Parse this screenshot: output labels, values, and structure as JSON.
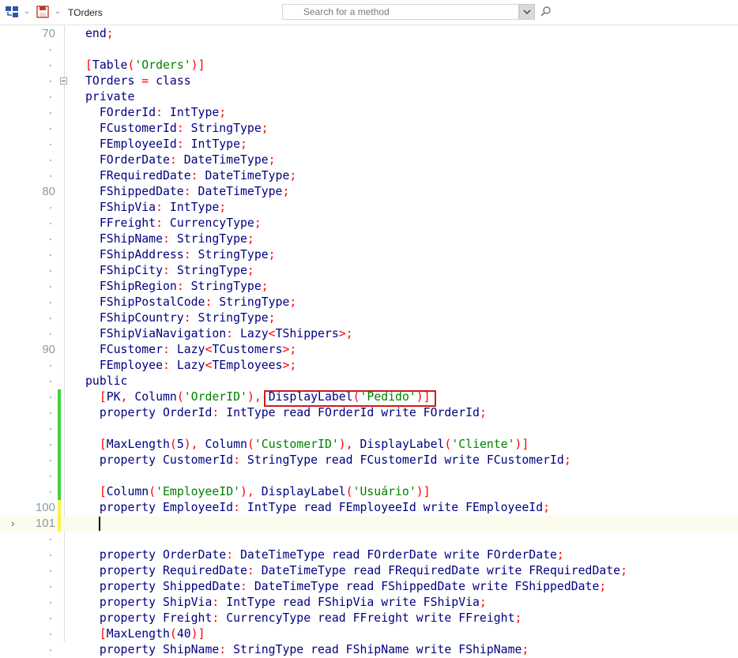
{
  "toolbar": {
    "class_name": "TOrders",
    "search": {
      "placeholder": "Search for a method"
    }
  },
  "editor": {
    "lines": [
      {
        "num": "70",
        "tokens": [
          {
            "t": "end",
            "c": "k"
          },
          {
            "t": ";",
            "c": "p"
          }
        ]
      },
      {
        "num": "",
        "tokens": []
      },
      {
        "num": "",
        "tokens": [
          {
            "t": "[",
            "c": "p"
          },
          {
            "t": "Table",
            "c": "i"
          },
          {
            "t": "(",
            "c": "p"
          },
          {
            "t": "'Orders'",
            "c": "s"
          },
          {
            "t": ")",
            "c": "p"
          },
          {
            "t": "]",
            "c": "p"
          }
        ]
      },
      {
        "num": "",
        "fold": true,
        "tokens": [
          {
            "t": "TOrders ",
            "c": "i"
          },
          {
            "t": "=",
            "c": "p"
          },
          {
            "t": " class",
            "c": "k"
          }
        ]
      },
      {
        "num": "",
        "tokens": [
          {
            "t": "private",
            "c": "k"
          }
        ]
      },
      {
        "num": "",
        "tokens": [
          {
            "t": "  FOrderId",
            "c": "i"
          },
          {
            "t": ":",
            "c": "p"
          },
          {
            "t": " IntType",
            "c": "i"
          },
          {
            "t": ";",
            "c": "p"
          }
        ]
      },
      {
        "num": "",
        "tokens": [
          {
            "t": "  FCustomerId",
            "c": "i"
          },
          {
            "t": ":",
            "c": "p"
          },
          {
            "t": " StringType",
            "c": "i"
          },
          {
            "t": ";",
            "c": "p"
          }
        ]
      },
      {
        "num": "",
        "tokens": [
          {
            "t": "  FEmployeeId",
            "c": "i"
          },
          {
            "t": ":",
            "c": "p"
          },
          {
            "t": " IntType",
            "c": "i"
          },
          {
            "t": ";",
            "c": "p"
          }
        ]
      },
      {
        "num": "",
        "tokens": [
          {
            "t": "  FOrderDate",
            "c": "i"
          },
          {
            "t": ":",
            "c": "p"
          },
          {
            "t": " DateTimeType",
            "c": "i"
          },
          {
            "t": ";",
            "c": "p"
          }
        ]
      },
      {
        "num": "",
        "tokens": [
          {
            "t": "  FRequiredDate",
            "c": "i"
          },
          {
            "t": ":",
            "c": "p"
          },
          {
            "t": " DateTimeType",
            "c": "i"
          },
          {
            "t": ";",
            "c": "p"
          }
        ]
      },
      {
        "num": "80",
        "tokens": [
          {
            "t": "  FShippedDate",
            "c": "i"
          },
          {
            "t": ":",
            "c": "p"
          },
          {
            "t": " DateTimeType",
            "c": "i"
          },
          {
            "t": ";",
            "c": "p"
          }
        ]
      },
      {
        "num": "",
        "tokens": [
          {
            "t": "  FShipVia",
            "c": "i"
          },
          {
            "t": ":",
            "c": "p"
          },
          {
            "t": " IntType",
            "c": "i"
          },
          {
            "t": ";",
            "c": "p"
          }
        ]
      },
      {
        "num": "",
        "tokens": [
          {
            "t": "  FFreight",
            "c": "i"
          },
          {
            "t": ":",
            "c": "p"
          },
          {
            "t": " CurrencyType",
            "c": "i"
          },
          {
            "t": ";",
            "c": "p"
          }
        ]
      },
      {
        "num": "",
        "tokens": [
          {
            "t": "  FShipName",
            "c": "i"
          },
          {
            "t": ":",
            "c": "p"
          },
          {
            "t": " StringType",
            "c": "i"
          },
          {
            "t": ";",
            "c": "p"
          }
        ]
      },
      {
        "num": "",
        "tokens": [
          {
            "t": "  FShipAddress",
            "c": "i"
          },
          {
            "t": ":",
            "c": "p"
          },
          {
            "t": " StringType",
            "c": "i"
          },
          {
            "t": ";",
            "c": "p"
          }
        ]
      },
      {
        "num": "",
        "tokens": [
          {
            "t": "  FShipCity",
            "c": "i"
          },
          {
            "t": ":",
            "c": "p"
          },
          {
            "t": " StringType",
            "c": "i"
          },
          {
            "t": ";",
            "c": "p"
          }
        ]
      },
      {
        "num": "",
        "tokens": [
          {
            "t": "  FShipRegion",
            "c": "i"
          },
          {
            "t": ":",
            "c": "p"
          },
          {
            "t": " StringType",
            "c": "i"
          },
          {
            "t": ";",
            "c": "p"
          }
        ]
      },
      {
        "num": "",
        "tokens": [
          {
            "t": "  FShipPostalCode",
            "c": "i"
          },
          {
            "t": ":",
            "c": "p"
          },
          {
            "t": " StringType",
            "c": "i"
          },
          {
            "t": ";",
            "c": "p"
          }
        ]
      },
      {
        "num": "",
        "tokens": [
          {
            "t": "  FShipCountry",
            "c": "i"
          },
          {
            "t": ":",
            "c": "p"
          },
          {
            "t": " StringType",
            "c": "i"
          },
          {
            "t": ";",
            "c": "p"
          }
        ]
      },
      {
        "num": "",
        "tokens": [
          {
            "t": "  FShipViaNavigation",
            "c": "i"
          },
          {
            "t": ":",
            "c": "p"
          },
          {
            "t": " Lazy",
            "c": "i"
          },
          {
            "t": "<",
            "c": "p"
          },
          {
            "t": "TShippers",
            "c": "i"
          },
          {
            "t": ">;",
            "c": "p"
          }
        ]
      },
      {
        "num": "90",
        "tokens": [
          {
            "t": "  FCustomer",
            "c": "i"
          },
          {
            "t": ":",
            "c": "p"
          },
          {
            "t": " Lazy",
            "c": "i"
          },
          {
            "t": "<",
            "c": "p"
          },
          {
            "t": "TCustomers",
            "c": "i"
          },
          {
            "t": ">;",
            "c": "p"
          }
        ]
      },
      {
        "num": "",
        "tokens": [
          {
            "t": "  FEmployee",
            "c": "i"
          },
          {
            "t": ":",
            "c": "p"
          },
          {
            "t": " Lazy",
            "c": "i"
          },
          {
            "t": "<",
            "c": "p"
          },
          {
            "t": "TEmployees",
            "c": "i"
          },
          {
            "t": ">;",
            "c": "p"
          }
        ]
      },
      {
        "num": "",
        "tokens": [
          {
            "t": "public",
            "c": "k"
          }
        ]
      },
      {
        "num": "",
        "bar": "green",
        "boxed": true,
        "tokens": [
          {
            "t": "  [",
            "c": "p"
          },
          {
            "t": "PK",
            "c": "i"
          },
          {
            "t": ",",
            "c": "p"
          },
          {
            "t": " Column",
            "c": "i"
          },
          {
            "t": "(",
            "c": "p"
          },
          {
            "t": "'OrderID'",
            "c": "s"
          },
          {
            "t": "),",
            "c": "p"
          },
          {
            "t": " DisplayLabel",
            "c": "i"
          },
          {
            "t": "(",
            "c": "p"
          },
          {
            "t": "'Pedido'",
            "c": "s"
          },
          {
            "t": ")",
            "c": "p"
          },
          {
            "t": "]",
            "c": "p"
          }
        ]
      },
      {
        "num": "",
        "bar": "green",
        "tokens": [
          {
            "t": "  property",
            "c": "k"
          },
          {
            "t": " OrderId",
            "c": "i"
          },
          {
            "t": ":",
            "c": "p"
          },
          {
            "t": " IntType",
            "c": "i"
          },
          {
            "t": " read",
            "c": "k"
          },
          {
            "t": " FOrderId",
            "c": "i"
          },
          {
            "t": " write",
            "c": "k"
          },
          {
            "t": " FOrderId",
            "c": "i"
          },
          {
            "t": ";",
            "c": "p"
          }
        ]
      },
      {
        "num": "",
        "bar": "green",
        "tokens": []
      },
      {
        "num": "",
        "bar": "green",
        "tokens": [
          {
            "t": "  [",
            "c": "p"
          },
          {
            "t": "MaxLength",
            "c": "i"
          },
          {
            "t": "(",
            "c": "p"
          },
          {
            "t": "5",
            "c": "i"
          },
          {
            "t": "),",
            "c": "p"
          },
          {
            "t": " Column",
            "c": "i"
          },
          {
            "t": "(",
            "c": "p"
          },
          {
            "t": "'CustomerID'",
            "c": "s"
          },
          {
            "t": "),",
            "c": "p"
          },
          {
            "t": " DisplayLabel",
            "c": "i"
          },
          {
            "t": "(",
            "c": "p"
          },
          {
            "t": "'Cliente'",
            "c": "s"
          },
          {
            "t": ")",
            "c": "p"
          },
          {
            "t": "]",
            "c": "p"
          }
        ]
      },
      {
        "num": "",
        "bar": "green",
        "tokens": [
          {
            "t": "  property",
            "c": "k"
          },
          {
            "t": " CustomerId",
            "c": "i"
          },
          {
            "t": ":",
            "c": "p"
          },
          {
            "t": " StringType",
            "c": "i"
          },
          {
            "t": " read",
            "c": "k"
          },
          {
            "t": " FCustomerId",
            "c": "i"
          },
          {
            "t": " write",
            "c": "k"
          },
          {
            "t": " FCustomerId",
            "c": "i"
          },
          {
            "t": ";",
            "c": "p"
          }
        ]
      },
      {
        "num": "",
        "bar": "green",
        "tokens": []
      },
      {
        "num": "",
        "bar": "green",
        "tokens": [
          {
            "t": "  [",
            "c": "p"
          },
          {
            "t": "Column",
            "c": "i"
          },
          {
            "t": "(",
            "c": "p"
          },
          {
            "t": "'EmployeeID'",
            "c": "s"
          },
          {
            "t": "),",
            "c": "p"
          },
          {
            "t": " DisplayLabel",
            "c": "i"
          },
          {
            "t": "(",
            "c": "p"
          },
          {
            "t": "'Usuário'",
            "c": "s"
          },
          {
            "t": ")",
            "c": "p"
          },
          {
            "t": "]",
            "c": "p"
          }
        ]
      },
      {
        "num": "100",
        "bar": "yellow",
        "tokens": [
          {
            "t": "  property",
            "c": "k"
          },
          {
            "t": " EmployeeId",
            "c": "i"
          },
          {
            "t": ":",
            "c": "p"
          },
          {
            "t": " IntType",
            "c": "i"
          },
          {
            "t": " read",
            "c": "k"
          },
          {
            "t": " FEmployeeId",
            "c": "i"
          },
          {
            "t": " write",
            "c": "k"
          },
          {
            "t": " FEmployeeId",
            "c": "i"
          },
          {
            "t": ";",
            "c": "p"
          }
        ]
      },
      {
        "num": "101",
        "bar": "yellow",
        "current": true,
        "caret": "›",
        "tokens": []
      },
      {
        "num": "",
        "tokens": []
      },
      {
        "num": "",
        "tokens": [
          {
            "t": "  property",
            "c": "k"
          },
          {
            "t": " OrderDate",
            "c": "i"
          },
          {
            "t": ":",
            "c": "p"
          },
          {
            "t": " DateTimeType",
            "c": "i"
          },
          {
            "t": " read",
            "c": "k"
          },
          {
            "t": " FOrderDate",
            "c": "i"
          },
          {
            "t": " write",
            "c": "k"
          },
          {
            "t": " FOrderDate",
            "c": "i"
          },
          {
            "t": ";",
            "c": "p"
          }
        ]
      },
      {
        "num": "",
        "tokens": [
          {
            "t": "  property",
            "c": "k"
          },
          {
            "t": " RequiredDate",
            "c": "i"
          },
          {
            "t": ":",
            "c": "p"
          },
          {
            "t": " DateTimeType",
            "c": "i"
          },
          {
            "t": " read",
            "c": "k"
          },
          {
            "t": " FRequiredDate",
            "c": "i"
          },
          {
            "t": " write",
            "c": "k"
          },
          {
            "t": " FRequiredDate",
            "c": "i"
          },
          {
            "t": ";",
            "c": "p"
          }
        ]
      },
      {
        "num": "",
        "tokens": [
          {
            "t": "  property",
            "c": "k"
          },
          {
            "t": " ShippedDate",
            "c": "i"
          },
          {
            "t": ":",
            "c": "p"
          },
          {
            "t": " DateTimeType",
            "c": "i"
          },
          {
            "t": " read",
            "c": "k"
          },
          {
            "t": " FShippedDate",
            "c": "i"
          },
          {
            "t": " write",
            "c": "k"
          },
          {
            "t": " FShippedDate",
            "c": "i"
          },
          {
            "t": ";",
            "c": "p"
          }
        ]
      },
      {
        "num": "",
        "tokens": [
          {
            "t": "  property",
            "c": "k"
          },
          {
            "t": " ShipVia",
            "c": "i"
          },
          {
            "t": ":",
            "c": "p"
          },
          {
            "t": " IntType",
            "c": "i"
          },
          {
            "t": " read",
            "c": "k"
          },
          {
            "t": " FShipVia",
            "c": "i"
          },
          {
            "t": " write",
            "c": "k"
          },
          {
            "t": " FShipVia",
            "c": "i"
          },
          {
            "t": ";",
            "c": "p"
          }
        ]
      },
      {
        "num": "",
        "tokens": [
          {
            "t": "  property",
            "c": "k"
          },
          {
            "t": " Freight",
            "c": "i"
          },
          {
            "t": ":",
            "c": "p"
          },
          {
            "t": " CurrencyType",
            "c": "i"
          },
          {
            "t": " read",
            "c": "k"
          },
          {
            "t": " FFreight",
            "c": "i"
          },
          {
            "t": " write",
            "c": "k"
          },
          {
            "t": " FFreight",
            "c": "i"
          },
          {
            "t": ";",
            "c": "p"
          }
        ]
      },
      {
        "num": "",
        "tokens": [
          {
            "t": "  [",
            "c": "p"
          },
          {
            "t": "MaxLength",
            "c": "i"
          },
          {
            "t": "(",
            "c": "p"
          },
          {
            "t": "40",
            "c": "i"
          },
          {
            "t": ")",
            "c": "p"
          },
          {
            "t": "]",
            "c": "p"
          }
        ]
      },
      {
        "num": "",
        "tokens": [
          {
            "t": "  property",
            "c": "k"
          },
          {
            "t": " ShipName",
            "c": "i"
          },
          {
            "t": ":",
            "c": "p"
          },
          {
            "t": " StringType",
            "c": "i"
          },
          {
            "t": " read",
            "c": "k"
          },
          {
            "t": " FShipName",
            "c": "i"
          },
          {
            "t": " write",
            "c": "k"
          },
          {
            "t": " FShipName",
            "c": "i"
          },
          {
            "t": ";",
            "c": "p"
          }
        ]
      }
    ]
  },
  "colors": {
    "keyword": "#000080",
    "identifier": "#000080",
    "symbol": "#ff0000",
    "string": "#008000",
    "modified_bar": "#3ed23e",
    "unsaved_bar": "#f6f24a",
    "current_line": "#fbfcee",
    "highlight_box": "#d11a1a"
  },
  "icons": [
    "structure-view-icon",
    "save-icon",
    "search-go-icon",
    "fold-collapse-icon",
    "chevron-down-icon"
  ]
}
